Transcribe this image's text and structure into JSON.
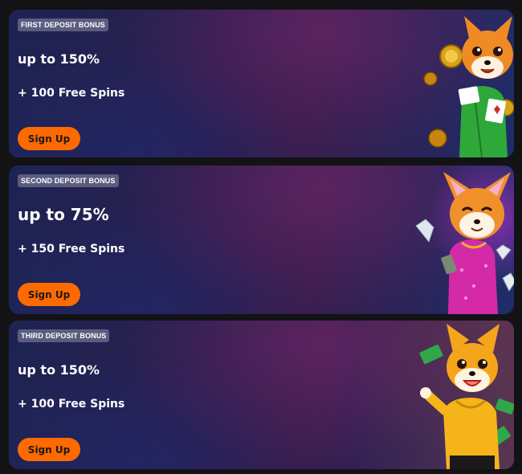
{
  "promos": [
    {
      "tag": "FIRST DEPOSIT BONUS",
      "headline": "up to 150%",
      "spins": "+ 100 Free Spins",
      "button_label": "Sign Up",
      "illustration": "fox-in-green-hoodie-with-cards-and-coins"
    },
    {
      "tag": "SECOND DEPOSIT BONUS",
      "headline": "up to 75%",
      "spins": "+ 150 Free Spins",
      "button_label": "Sign Up",
      "illustration": "fox-in-pink-sequin-dress-with-diamonds"
    },
    {
      "tag": "THIRD DEPOSIT BONUS",
      "headline": "up to 150%",
      "spins": "+ 100 Free Spins",
      "button_label": "Sign Up",
      "illustration": "fox-in-yellow-shirt-with-cash"
    }
  ],
  "colors": {
    "page_bg": "#131316",
    "button_bg": "#ff6a00",
    "text": "#ffffff"
  }
}
